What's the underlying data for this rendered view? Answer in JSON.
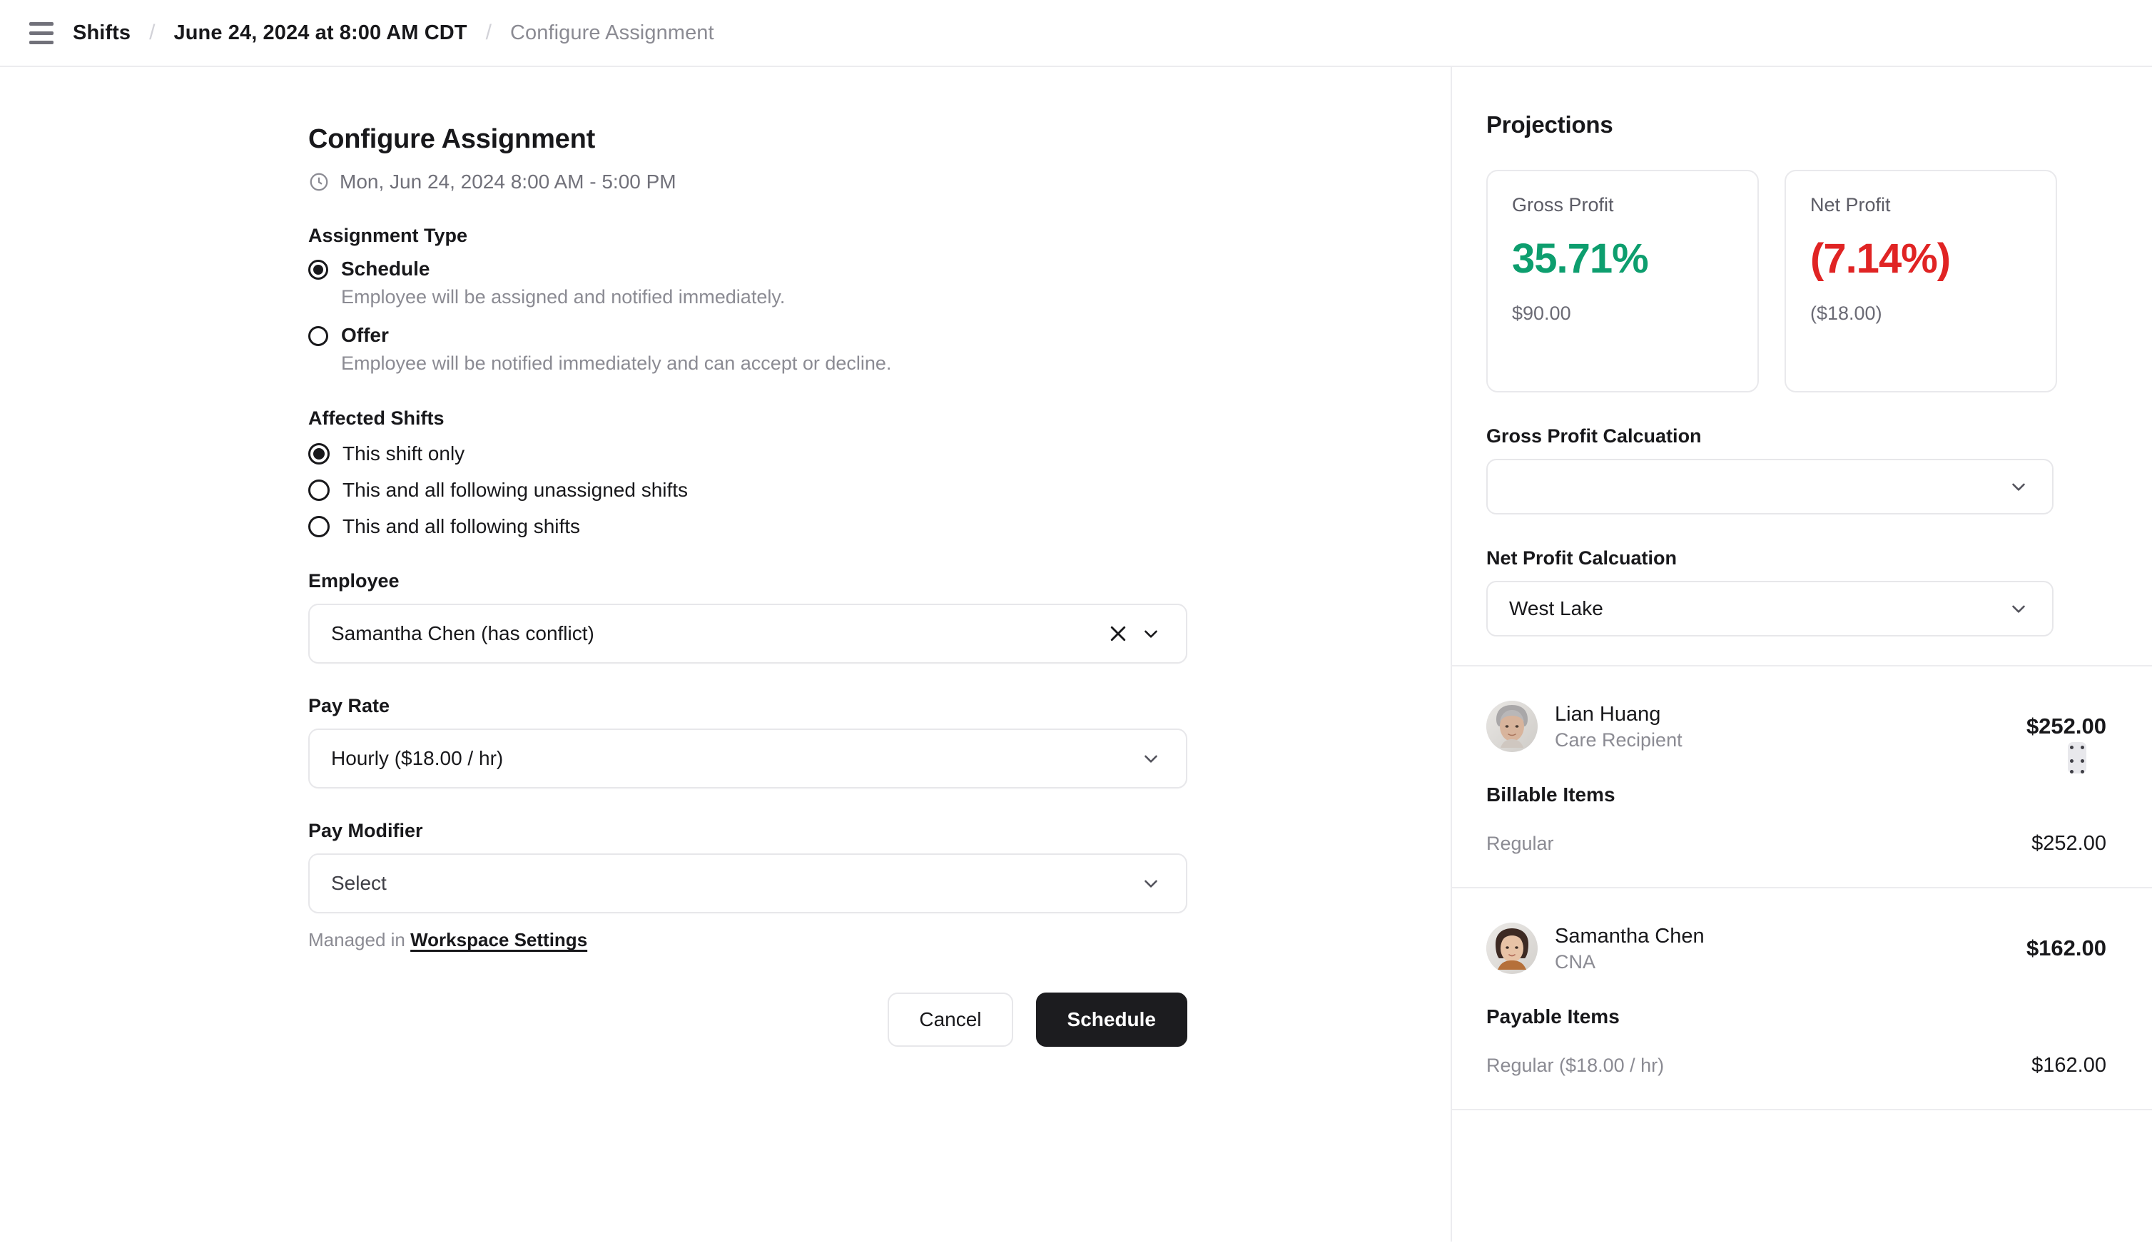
{
  "topbar": {
    "menu_icon": "hamburger-icon",
    "breadcrumbs": [
      {
        "label": "Shifts",
        "muted": false
      },
      {
        "label": "June 24, 2024 at 8:00 AM CDT",
        "muted": false
      },
      {
        "label": "Configure Assignment",
        "muted": true
      }
    ],
    "separator": "/"
  },
  "form": {
    "title": "Configure Assignment",
    "schedule_time": "Mon, Jun 24, 2024 8:00 AM - 5:00 PM",
    "clock_icon": "clock-icon",
    "assignment_type": {
      "label": "Assignment Type",
      "options": [
        {
          "title": "Schedule",
          "desc": "Employee will be assigned and notified immediately.",
          "selected": true
        },
        {
          "title": "Offer",
          "desc": "Employee will be notified immediately and can accept or decline.",
          "selected": false
        }
      ]
    },
    "affected_shifts": {
      "label": "Affected Shifts",
      "options": [
        {
          "title": "This shift only",
          "selected": true
        },
        {
          "title": "This and all following unassigned shifts",
          "selected": false
        },
        {
          "title": "This and all following shifts",
          "selected": false
        }
      ]
    },
    "employee": {
      "label": "Employee",
      "value": "Samantha Chen (has conflict)",
      "clear_icon": "x-icon",
      "chevron_icon": "chevron-down-icon"
    },
    "pay_rate": {
      "label": "Pay Rate",
      "value": "Hourly ($18.00 / hr)",
      "chevron_icon": "chevron-down-icon"
    },
    "pay_modifier": {
      "label": "Pay Modifier",
      "value": "Select",
      "chevron_icon": "chevron-down-icon"
    },
    "managed_prefix": "Managed in ",
    "managed_link": "Workspace Settings",
    "cancel_label": "Cancel",
    "submit_label": "Schedule"
  },
  "projections": {
    "title": "Projections",
    "cards": [
      {
        "label": "Gross Profit",
        "value": "35.71%",
        "sub": "$90.00",
        "color": "#0d9e6e"
      },
      {
        "label": "Net Profit",
        "value": "(7.14%)",
        "sub": "($18.00)",
        "color": "#e02424"
      }
    ],
    "gross_calc": {
      "label": "Gross Profit Calcuation",
      "value": "",
      "chevron_icon": "chevron-down-icon"
    },
    "net_calc": {
      "label": "Net Profit Calcuation",
      "value": "West Lake",
      "chevron_icon": "chevron-down-icon"
    }
  },
  "parties": [
    {
      "avatar": "avatar-lian-huang",
      "name": "Lian Huang",
      "role": "Care Recipient",
      "total": "$252.00",
      "items_title": "Billable Items",
      "items": [
        {
          "name": "Regular",
          "amount": "$252.00"
        }
      ]
    },
    {
      "avatar": "avatar-samantha-chen",
      "name": "Samantha Chen",
      "role": "CNA",
      "total": "$162.00",
      "items_title": "Payable Items",
      "items": [
        {
          "name": "Regular ($18.00 / hr)",
          "amount": "$162.00"
        }
      ]
    }
  ],
  "resize_handle": "panel-resize-grip"
}
